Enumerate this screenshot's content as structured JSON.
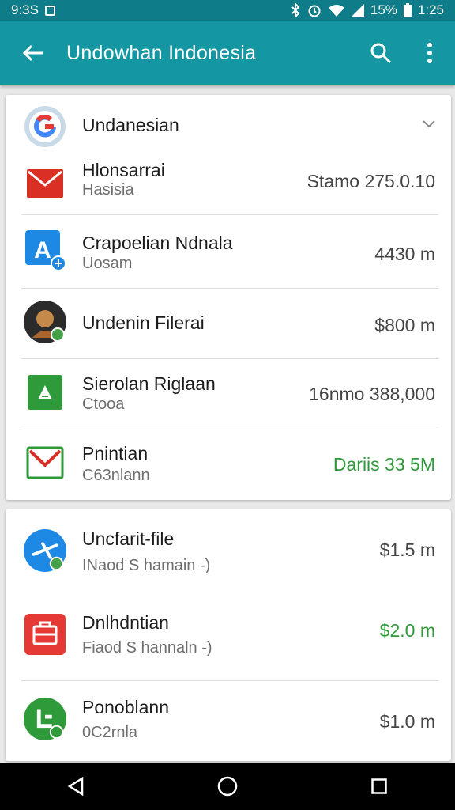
{
  "status": {
    "left": "9:3S",
    "battery": "15%",
    "time": "1:25"
  },
  "appbar": {
    "title": "Undowhan Indonesia"
  },
  "card1": {
    "header": {
      "label": "Undanesian"
    },
    "items": [
      {
        "icon": "mail-icon",
        "title": "Hlonsarrai",
        "subtitle": "Hasisia",
        "amount": "Stamo 275.0.10",
        "green": false
      },
      {
        "icon": "app-a-icon",
        "title": "Crapoelian Ndnala",
        "subtitle": "Uosam",
        "amount": "4430 m",
        "green": false
      },
      {
        "icon": "avatar-icon",
        "title": "Undenin Filerai",
        "subtitle": "",
        "amount": "$800 m",
        "green": false
      },
      {
        "icon": "drive-icon",
        "title": "Sierolan Riglaan",
        "subtitle": "Ctooa",
        "amount": "16nmo 388,000",
        "green": false
      },
      {
        "icon": "gmail-icon",
        "title": "Pnintian",
        "subtitle": "C63nlann",
        "amount": "Dariis 33 5M",
        "green": true
      }
    ]
  },
  "card2": {
    "items": [
      {
        "icon": "plane-icon",
        "title": "Uncfarit-file",
        "subtitle": "INaod S hamain -)",
        "amount": "$1.5 m",
        "green": false
      },
      {
        "icon": "bag-icon",
        "title": "Dnlhdntian",
        "subtitle": "Fiaod S hannaln -)",
        "amount": "$2.0 m",
        "green": true
      },
      {
        "icon": "phone-icon",
        "title": "Ponoblann",
        "subtitle": "0C2rnla",
        "amount": "$1.0 m",
        "green": false
      }
    ]
  },
  "colors": {
    "statusbar": "#0f7c8a",
    "appbar": "#1496a3",
    "green": "#2e9a3a"
  }
}
